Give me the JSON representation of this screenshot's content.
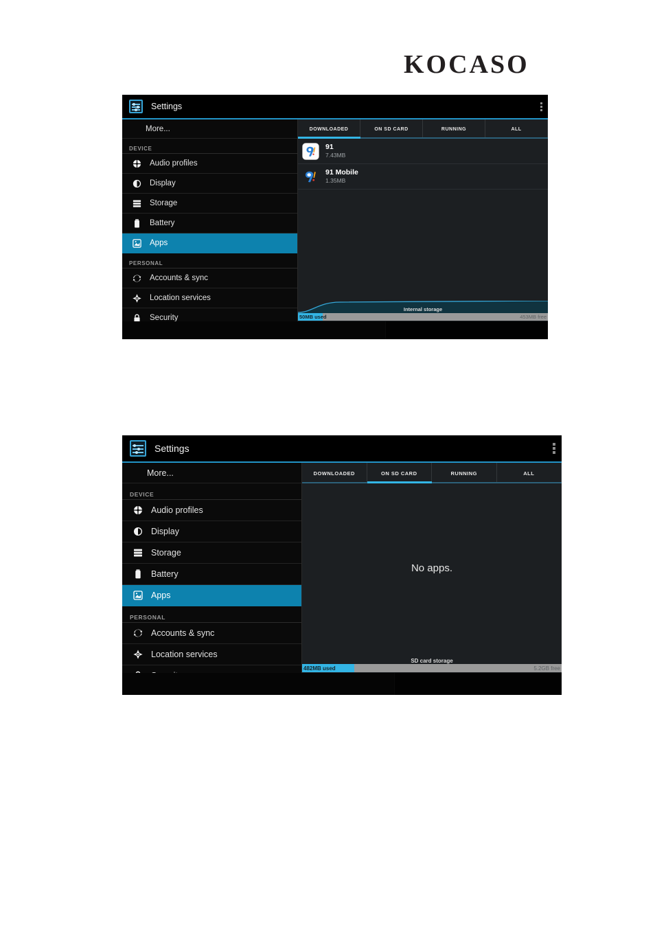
{
  "brand": {
    "logo_text": "KOCASO"
  },
  "shared": {
    "action_bar": {
      "title": "Settings",
      "app_icon": "settings-sliders-icon",
      "overflow_icon": "overflow-menu-icon"
    },
    "sidebar": {
      "more_label": "More...",
      "sections": [
        {
          "header": "DEVICE",
          "items": [
            {
              "label": "Audio profiles",
              "icon": "audio-profiles-icon"
            },
            {
              "label": "Display",
              "icon": "display-brightness-icon"
            },
            {
              "label": "Storage",
              "icon": "storage-stack-icon"
            },
            {
              "label": "Battery",
              "icon": "battery-icon"
            },
            {
              "label": "Apps",
              "icon": "apps-icon",
              "active": true
            }
          ]
        },
        {
          "header": "PERSONAL",
          "items": [
            {
              "label": "Accounts & sync",
              "icon": "sync-icon"
            },
            {
              "label": "Location services",
              "icon": "location-icon"
            },
            {
              "label": "Security",
              "icon": "lock-icon"
            }
          ]
        }
      ]
    },
    "tabs": [
      {
        "label": "DOWNLOADED"
      },
      {
        "label": "ON SD CARD"
      },
      {
        "label": "RUNNING"
      },
      {
        "label": "ALL"
      }
    ],
    "accent_color": "#33b5e5",
    "highlight_color": "#0d82ae"
  },
  "screenshot_one": {
    "active_tab": "DOWNLOADED",
    "apps": [
      {
        "name": "91",
        "size": "7.43MB",
        "icon": "app-91-icon"
      },
      {
        "name": "91 Mobile",
        "size": "1.35MB",
        "icon": "app-91-mobile-icon"
      }
    ],
    "storage": {
      "label": "Internal storage",
      "used_text": "50MB used",
      "free_text": "453MB free",
      "used_percent": 10
    }
  },
  "screenshot_two": {
    "active_tab": "ON SD CARD",
    "empty_message": "No apps.",
    "storage": {
      "label": "SD card storage",
      "used_text": "482MB used",
      "free_text": "5.2GB free",
      "used_percent": 20
    }
  }
}
